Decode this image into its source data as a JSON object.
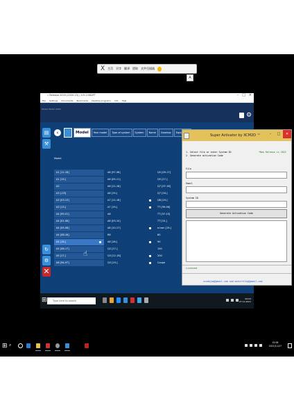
{
  "screen_toolbar": {
    "close": "X",
    "items": [
      "主页",
      "识字",
      "翻译",
      "提取",
      "文件扫描器"
    ],
    "a_label": "A"
  },
  "inner_window": {
    "title": "« Release 2020 (2020.23) | V.9.1 KKDFT",
    "menu": [
      "File",
      "Settings",
      "Documents",
      "Bookmarks",
      "Desktop programs",
      "Info",
      "Help"
    ],
    "subtitle": "Model Model 2020"
  },
  "tabs": {
    "back": "‹",
    "items": [
      "Model",
      "Year model",
      "Type of system",
      "System",
      "Name",
      "Gearbox",
      "Equipment"
    ]
  },
  "model_header": "Model",
  "models": [
    [
      "A1 [11-18]",
      "A6 [97-06]",
      "Q5 [09-17]"
    ],
    [
      "A1 [19-]",
      "A6 [05-11]",
      "Q5 [17-]"
    ],
    [
      "A2",
      "A6 [11-18]",
      "Q7 [07-16]"
    ],
    [
      "A3 [-03]",
      "A6 [19-]",
      "Q7 [16-]"
    ],
    [
      "A3 [03-13]",
      "A7 [11-18]",
      "Q8 [19-]"
    ],
    [
      "A3 [13-]",
      "A7 [19-]",
      "TT [99-06]"
    ],
    [
      "A4 [95-01]",
      "A8",
      "TT [07-15]"
    ],
    [
      "A4 [01-08]",
      "A8 [03-10]",
      "TT [15-]"
    ],
    [
      "A4 [05-08]",
      "A8 [10-17]",
      "e-tron [19-]"
    ],
    [
      "A4 [08-16]",
      "R8",
      "80"
    ],
    [
      "A4 [16-]",
      "A8 [18-]",
      "90"
    ],
    [
      "A5 [08-17]",
      "Q2 [17-]",
      "100"
    ],
    [
      "A5 [17-]",
      "Q3 [12-18]",
      "200"
    ],
    [
      "A6 [94-97]",
      "Q3 [19-]",
      "Coupe"
    ]
  ],
  "inner_taskbar": {
    "search": "Type here to search",
    "time": "09:03",
    "date": "27.11.2021"
  },
  "activator": {
    "title": "Super Activator by XCM2D ™",
    "steps": [
      "1. Select file or enter System ID",
      "2. Generate activation Code"
    ],
    "note": "*New Release in 2022",
    "file_label": "File",
    "email_label": "Email",
    "system_label": "System ID",
    "generate_button": "Generate Activation Code",
    "status": "Licensed",
    "footer": "xcodejpq@gmail.com and motorfileg@gmail.com"
  },
  "outer_taskbar": {
    "time": "15:08",
    "date": "2021/11/27"
  }
}
